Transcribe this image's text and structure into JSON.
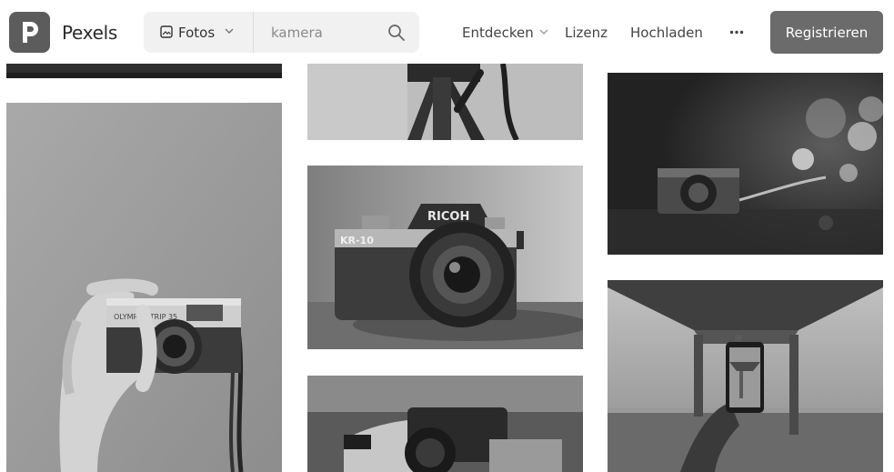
{
  "header": {
    "brand": "Pexels",
    "search": {
      "type_label": "Fotos",
      "query": "kamera"
    },
    "nav": {
      "entdecken": "Entdecken",
      "lizenz": "Lizenz",
      "hochladen": "Hochladen",
      "more": "•••",
      "register": "Registrieren"
    }
  },
  "photos": [
    {
      "id": "photo-hand-olympus-camera",
      "text": "OLYMPUS TRIP 35"
    },
    {
      "id": "photo-tripod-camera"
    },
    {
      "id": "photo-ricoh-camera",
      "text": "RICOH",
      "text2": "KR-10"
    },
    {
      "id": "photo-person-holding-camera"
    },
    {
      "id": "photo-vintage-camera-lights"
    },
    {
      "id": "photo-phone-under-pier"
    },
    {
      "id": "photo-top-strip"
    }
  ]
}
